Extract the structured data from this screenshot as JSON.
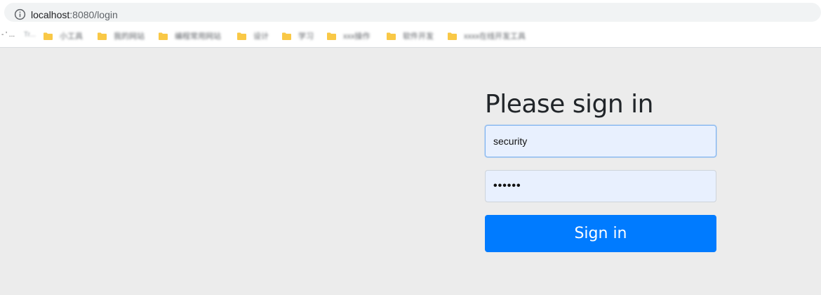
{
  "browser": {
    "url_host": "localhost",
    "url_path": ":8080/login",
    "bookmarks": {
      "first": "-  ' ...",
      "first_blurred": "Tr...",
      "items": [
        {
          "label": "小工具"
        },
        {
          "label": "我的网站"
        },
        {
          "label": "编程常用网站"
        },
        {
          "label": "设计"
        },
        {
          "label": "学习"
        },
        {
          "label": "xxx操作"
        },
        {
          "label": "软件开发"
        },
        {
          "label": "xxxx在线开发工具"
        }
      ]
    }
  },
  "login": {
    "heading": "Please sign in",
    "username_value": "security",
    "password_value": "••••••",
    "submit_label": "Sign in"
  },
  "colors": {
    "page_background": "#ececec",
    "button": "#007bff",
    "autofill": "#e8f0fe",
    "folder": "#f9c846"
  }
}
